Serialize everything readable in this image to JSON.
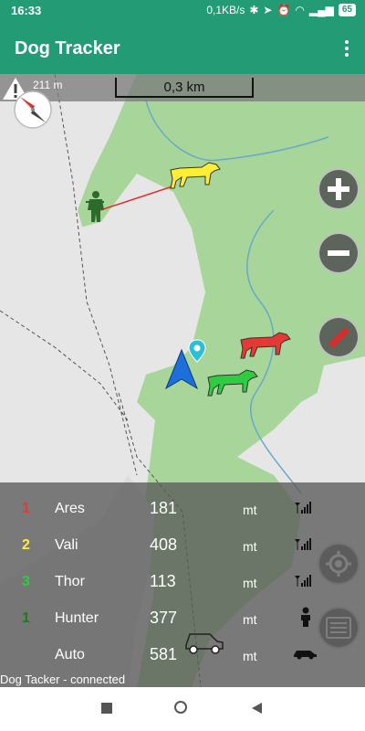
{
  "status_bar": {
    "time": "16:33",
    "network_speed": "0,1KB/s",
    "battery": "65"
  },
  "app_bar": {
    "title": "Dog Tracker",
    "menu_icon": "overflow-menu-icon"
  },
  "map": {
    "distance_label": "211 m",
    "scale_label": "0,3 km"
  },
  "map_buttons": {
    "zoom_in": "plus-icon",
    "zoom_out": "minus-icon",
    "measure": "ruler-icon",
    "locate": "target-icon",
    "layers": "layers-icon"
  },
  "tracked": [
    {
      "num": "1",
      "name": "Ares",
      "distance": "181",
      "unit": "mt",
      "color": "#e53935",
      "icon": "signal-icon"
    },
    {
      "num": "2",
      "name": "Vali",
      "distance": "408",
      "unit": "mt",
      "color": "#ffee33",
      "icon": "signal-icon"
    },
    {
      "num": "3",
      "name": "Thor",
      "distance": "113",
      "unit": "mt",
      "color": "#2ecc40",
      "icon": "signal-icon"
    },
    {
      "num": "1",
      "name": "Hunter",
      "distance": "377",
      "unit": "mt",
      "color": "#1e7a1e",
      "icon": "person-icon"
    },
    {
      "num": "",
      "name": "Auto",
      "distance": "581",
      "unit": "mt",
      "color": "#ffffff",
      "icon": "car-icon"
    }
  ],
  "status_line": "Dog Tacker - connected",
  "colors": {
    "accent": "#239c76",
    "forest": "#a8d69a",
    "clearing": "#e6e6e6"
  }
}
